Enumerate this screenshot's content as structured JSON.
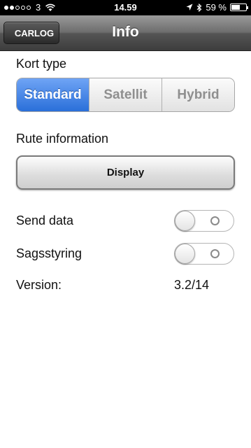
{
  "status_bar": {
    "carrier": "3",
    "time": "14.59",
    "battery_text": "59 %",
    "battery_level": 0.59,
    "signal_icon": "signal-dots-icon",
    "wifi_icon": "wifi-icon",
    "location_icon": "location-arrow-icon",
    "bluetooth_icon": "bluetooth-icon"
  },
  "nav": {
    "back_label": "CARLOG",
    "title": "Info"
  },
  "map_type": {
    "label": "Kort type",
    "options": [
      "Standard",
      "Satellit",
      "Hybrid"
    ],
    "selected": "Standard"
  },
  "route_info": {
    "label": "Rute information",
    "button_label": "Display"
  },
  "settings": {
    "send_data": {
      "label": "Send data",
      "on": false
    },
    "case_mgmt": {
      "label": "Sagsstyring",
      "on": false
    }
  },
  "version": {
    "label": "Version:",
    "value": "3.2/14"
  },
  "colors": {
    "accent": "#2a6fd9",
    "nav_bar": "#555555"
  }
}
